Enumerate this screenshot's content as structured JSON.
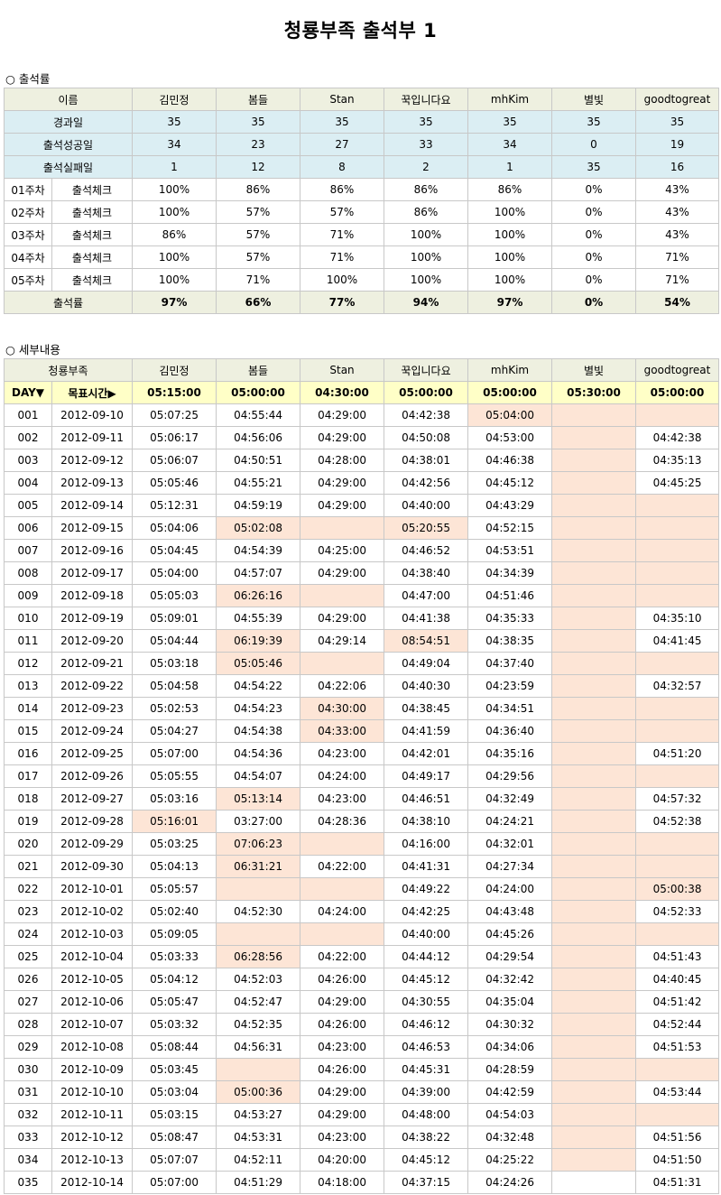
{
  "title": "청룡부족 출석부 1",
  "colors": {
    "header_bg": "#eef0e0",
    "summary_bg": "#dbeef3",
    "target_bg": "#ffffc7",
    "missed_bg": "#fde5d6"
  },
  "rate_section": {
    "heading": "○ 출석률",
    "name_label": "이름",
    "members": [
      "김민정",
      "봄들",
      "Stan",
      "꾹입니다요",
      "mhKim",
      "별빛",
      "goodtogreat"
    ],
    "stats": [
      {
        "label": "경과일",
        "values": [
          "35",
          "35",
          "35",
          "35",
          "35",
          "35",
          "35"
        ]
      },
      {
        "label": "출석성공일",
        "values": [
          "34",
          "23",
          "27",
          "33",
          "34",
          "0",
          "19"
        ]
      },
      {
        "label": "출석실패일",
        "values": [
          "1",
          "12",
          "8",
          "2",
          "1",
          "35",
          "16"
        ]
      }
    ],
    "weeks": [
      {
        "week": "01주차",
        "check": "출석체크",
        "values": [
          "100%",
          "86%",
          "86%",
          "86%",
          "86%",
          "0%",
          "43%"
        ]
      },
      {
        "week": "02주차",
        "check": "출석체크",
        "values": [
          "100%",
          "57%",
          "57%",
          "86%",
          "100%",
          "0%",
          "43%"
        ]
      },
      {
        "week": "03주차",
        "check": "출석체크",
        "values": [
          "86%",
          "57%",
          "71%",
          "100%",
          "100%",
          "0%",
          "43%"
        ]
      },
      {
        "week": "04주차",
        "check": "출석체크",
        "values": [
          "100%",
          "57%",
          "71%",
          "100%",
          "100%",
          "0%",
          "71%"
        ]
      },
      {
        "week": "05주차",
        "check": "출석체크",
        "values": [
          "100%",
          "71%",
          "100%",
          "100%",
          "100%",
          "0%",
          "71%"
        ]
      }
    ],
    "total": {
      "label": "출석률",
      "values": [
        "97%",
        "66%",
        "77%",
        "94%",
        "97%",
        "0%",
        "54%"
      ]
    }
  },
  "detail_section": {
    "heading": "○ 세부내용",
    "tribe_label": "청룡부족",
    "day_label": "DAY▼",
    "target_label": "목표시간▶",
    "targets": [
      "05:15:00",
      "05:00:00",
      "04:30:00",
      "05:00:00",
      "05:00:00",
      "05:30:00",
      "05:00:00"
    ],
    "rows": [
      {
        "day": "001",
        "date": "2012-09-10",
        "times": [
          "05:07:25",
          "04:55:44",
          "04:29:00",
          "04:42:38",
          "05:04:00",
          "",
          ""
        ],
        "missed": [
          4,
          5,
          6
        ]
      },
      {
        "day": "002",
        "date": "2012-09-11",
        "times": [
          "05:06:17",
          "04:56:06",
          "04:29:00",
          "04:50:08",
          "04:53:00",
          "",
          "04:42:38"
        ],
        "missed": [
          5
        ]
      },
      {
        "day": "003",
        "date": "2012-09-12",
        "times": [
          "05:06:07",
          "04:50:51",
          "04:28:00",
          "04:38:01",
          "04:46:38",
          "",
          "04:35:13"
        ],
        "missed": [
          5
        ]
      },
      {
        "day": "004",
        "date": "2012-09-13",
        "times": [
          "05:05:46",
          "04:55:21",
          "04:29:00",
          "04:42:56",
          "04:45:12",
          "",
          "04:45:25"
        ],
        "missed": [
          5
        ]
      },
      {
        "day": "005",
        "date": "2012-09-14",
        "times": [
          "05:12:31",
          "04:59:19",
          "04:29:00",
          "04:40:00",
          "04:43:29",
          "",
          ""
        ],
        "missed": [
          5,
          6
        ]
      },
      {
        "day": "006",
        "date": "2012-09-15",
        "times": [
          "05:04:06",
          "05:02:08",
          "",
          "05:20:55",
          "04:52:15",
          "",
          ""
        ],
        "missed": [
          1,
          2,
          3,
          5,
          6
        ]
      },
      {
        "day": "007",
        "date": "2012-09-16",
        "times": [
          "05:04:45",
          "04:54:39",
          "04:25:00",
          "04:46:52",
          "04:53:51",
          "",
          ""
        ],
        "missed": [
          5,
          6
        ]
      },
      {
        "day": "008",
        "date": "2012-09-17",
        "times": [
          "05:04:00",
          "04:57:07",
          "04:29:00",
          "04:38:40",
          "04:34:39",
          "",
          ""
        ],
        "missed": [
          5,
          6
        ]
      },
      {
        "day": "009",
        "date": "2012-09-18",
        "times": [
          "05:05:03",
          "06:26:16",
          "",
          "04:47:00",
          "04:51:46",
          "",
          ""
        ],
        "missed": [
          1,
          2,
          5,
          6
        ]
      },
      {
        "day": "010",
        "date": "2012-09-19",
        "times": [
          "05:09:01",
          "04:55:39",
          "04:29:00",
          "04:41:38",
          "04:35:33",
          "",
          "04:35:10"
        ],
        "missed": [
          5
        ]
      },
      {
        "day": "011",
        "date": "2012-09-20",
        "times": [
          "05:04:44",
          "06:19:39",
          "04:29:14",
          "08:54:51",
          "04:38:35",
          "",
          "04:41:45"
        ],
        "missed": [
          1,
          3,
          5
        ]
      },
      {
        "day": "012",
        "date": "2012-09-21",
        "times": [
          "05:03:18",
          "05:05:46",
          "",
          "04:49:04",
          "04:37:40",
          "",
          ""
        ],
        "missed": [
          1,
          2,
          5,
          6
        ]
      },
      {
        "day": "013",
        "date": "2012-09-22",
        "times": [
          "05:04:58",
          "04:54:22",
          "04:22:06",
          "04:40:30",
          "04:23:59",
          "",
          "04:32:57"
        ],
        "missed": [
          5
        ]
      },
      {
        "day": "014",
        "date": "2012-09-23",
        "times": [
          "05:02:53",
          "04:54:23",
          "04:30:00",
          "04:38:45",
          "04:34:51",
          "",
          ""
        ],
        "missed": [
          2,
          5,
          6
        ]
      },
      {
        "day": "015",
        "date": "2012-09-24",
        "times": [
          "05:04:27",
          "04:54:38",
          "04:33:00",
          "04:41:59",
          "04:36:40",
          "",
          ""
        ],
        "missed": [
          2,
          5,
          6
        ]
      },
      {
        "day": "016",
        "date": "2012-09-25",
        "times": [
          "05:07:00",
          "04:54:36",
          "04:23:00",
          "04:42:01",
          "04:35:16",
          "",
          "04:51:20"
        ],
        "missed": [
          5
        ]
      },
      {
        "day": "017",
        "date": "2012-09-26",
        "times": [
          "05:05:55",
          "04:54:07",
          "04:24:00",
          "04:49:17",
          "04:29:56",
          "",
          ""
        ],
        "missed": [
          5,
          6
        ]
      },
      {
        "day": "018",
        "date": "2012-09-27",
        "times": [
          "05:03:16",
          "05:13:14",
          "04:23:00",
          "04:46:51",
          "04:32:49",
          "",
          "04:57:32"
        ],
        "missed": [
          1,
          5
        ]
      },
      {
        "day": "019",
        "date": "2012-09-28",
        "times": [
          "05:16:01",
          "03:27:00",
          "04:28:36",
          "04:38:10",
          "04:24:21",
          "",
          "04:52:38"
        ],
        "missed": [
          0,
          5
        ]
      },
      {
        "day": "020",
        "date": "2012-09-29",
        "times": [
          "05:03:25",
          "07:06:23",
          "",
          "04:16:00",
          "04:32:01",
          "",
          ""
        ],
        "missed": [
          1,
          2,
          5,
          6
        ]
      },
      {
        "day": "021",
        "date": "2012-09-30",
        "times": [
          "05:04:13",
          "06:31:21",
          "04:22:00",
          "04:41:31",
          "04:27:34",
          "",
          ""
        ],
        "missed": [
          1,
          5,
          6
        ]
      },
      {
        "day": "022",
        "date": "2012-10-01",
        "times": [
          "05:05:57",
          "",
          "",
          "04:49:22",
          "04:24:00",
          "",
          "05:00:38"
        ],
        "missed": [
          1,
          2,
          5,
          6
        ]
      },
      {
        "day": "023",
        "date": "2012-10-02",
        "times": [
          "05:02:40",
          "04:52:30",
          "04:24:00",
          "04:42:25",
          "04:43:48",
          "",
          "04:52:33"
        ],
        "missed": [
          5
        ]
      },
      {
        "day": "024",
        "date": "2012-10-03",
        "times": [
          "05:09:05",
          "",
          "",
          "04:40:00",
          "04:45:26",
          "",
          ""
        ],
        "missed": [
          1,
          2,
          5,
          6
        ]
      },
      {
        "day": "025",
        "date": "2012-10-04",
        "times": [
          "05:03:33",
          "06:28:56",
          "04:22:00",
          "04:44:12",
          "04:29:54",
          "",
          "04:51:43"
        ],
        "missed": [
          1,
          5
        ]
      },
      {
        "day": "026",
        "date": "2012-10-05",
        "times": [
          "05:04:12",
          "04:52:03",
          "04:26:00",
          "04:45:12",
          "04:32:42",
          "",
          "04:40:45"
        ],
        "missed": [
          5
        ]
      },
      {
        "day": "027",
        "date": "2012-10-06",
        "times": [
          "05:05:47",
          "04:52:47",
          "04:29:00",
          "04:30:55",
          "04:35:04",
          "",
          "04:51:42"
        ],
        "missed": [
          5
        ]
      },
      {
        "day": "028",
        "date": "2012-10-07",
        "times": [
          "05:03:32",
          "04:52:35",
          "04:26:00",
          "04:46:12",
          "04:30:32",
          "",
          "04:52:44"
        ],
        "missed": [
          5
        ]
      },
      {
        "day": "029",
        "date": "2012-10-08",
        "times": [
          "05:08:44",
          "04:56:31",
          "04:23:00",
          "04:46:53",
          "04:34:06",
          "",
          "04:51:53"
        ],
        "missed": [
          5
        ]
      },
      {
        "day": "030",
        "date": "2012-10-09",
        "times": [
          "05:03:45",
          "",
          "04:26:00",
          "04:45:31",
          "04:28:59",
          "",
          ""
        ],
        "missed": [
          1,
          5,
          6
        ]
      },
      {
        "day": "031",
        "date": "2012-10-10",
        "times": [
          "05:03:04",
          "05:00:36",
          "04:29:00",
          "04:39:00",
          "04:42:59",
          "",
          "04:53:44"
        ],
        "missed": [
          1,
          5
        ]
      },
      {
        "day": "032",
        "date": "2012-10-11",
        "times": [
          "05:03:15",
          "04:53:27",
          "04:29:00",
          "04:48:00",
          "04:54:03",
          "",
          ""
        ],
        "missed": [
          5,
          6
        ]
      },
      {
        "day": "033",
        "date": "2012-10-12",
        "times": [
          "05:08:47",
          "04:53:31",
          "04:23:00",
          "04:38:22",
          "04:32:48",
          "",
          "04:51:56"
        ],
        "missed": [
          5
        ]
      },
      {
        "day": "034",
        "date": "2012-10-13",
        "times": [
          "05:07:07",
          "04:52:11",
          "04:20:00",
          "04:45:12",
          "04:25:22",
          "",
          "04:51:50"
        ],
        "missed": [
          5
        ]
      },
      {
        "day": "035",
        "date": "2012-10-14",
        "times": [
          "05:07:00",
          "04:51:29",
          "04:18:00",
          "04:37:15",
          "04:24:26",
          "",
          "04:51:31"
        ],
        "missed": []
      }
    ]
  }
}
